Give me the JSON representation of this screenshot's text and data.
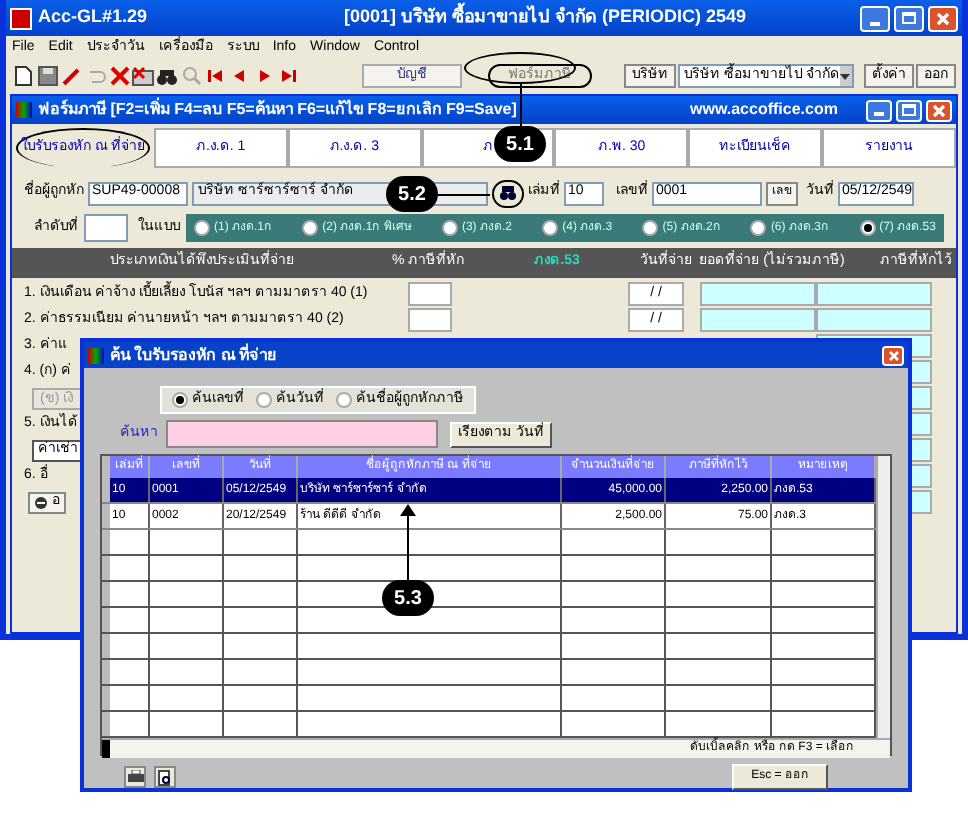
{
  "window": {
    "app": "Acc-GL#1.29",
    "title": "[0001]  บริษัท ซื้อมาขายไป จำกัด (PERIODIC)  2549"
  },
  "menu": [
    "File",
    "Edit",
    "ประจำวัน",
    "เครื่องมือ",
    "ระบบ",
    "Info",
    "Window",
    "Control"
  ],
  "toolbar": {
    "buttons": [
      {
        "label": "บัญชี",
        "selected": false
      },
      {
        "label": "ฟอร์มภาษี",
        "selected": true
      }
    ],
    "company_button": "บริษัท",
    "company_select": "บริษัท ซื้อมาขายไป จำกัด",
    "settings_button": "ตั้งค่า",
    "exit_button": "ออก"
  },
  "child_window": {
    "title": "ฟอร์มภาษี   [F2=เพิ่ม  F4=ลบ  F5=ค้นหา  F6=แก้ไข  F8=ยกเลิก  F9=Save]",
    "website": "www.accoffice.com"
  },
  "tabs": [
    {
      "label": "ใบรับรองหัก ณ ที่จ่าย",
      "selected": true
    },
    {
      "label": "ภ.ง.ด. 1",
      "selected": false
    },
    {
      "label": "ภ.ง.ด. 3",
      "selected": false
    },
    {
      "label": "ภ",
      "selected": false
    },
    {
      "label": "ภ.พ. 30",
      "selected": false
    },
    {
      "label": "ทะเบียนเช็ค",
      "selected": false
    },
    {
      "label": "รายงาน",
      "selected": false
    }
  ],
  "form": {
    "payee_label": "ชื่อผู้ถูกหัก",
    "payee_code": "SUP49-00008",
    "payee_name": "บริษัท ซาร์ซาร์ซาร์ จำกัด",
    "book_label": "เล่มที่",
    "book": "10",
    "number_label": "เลขที่",
    "number": "0001",
    "number_button": "เลข",
    "date_label": "วันที่",
    "date": "05/12/2549",
    "seq_label": "ลำดับที่",
    "form_label": "ในแบบ",
    "form_types": [
      {
        "label": "(1) ภงด.1ก",
        "selected": false
      },
      {
        "label": "(2) ภงด.1ก พิเศษ",
        "selected": false
      },
      {
        "label": "(3) ภงด.2",
        "selected": false
      },
      {
        "label": "(4) ภงด.3",
        "selected": false
      },
      {
        "label": "(5) ภงด.2ก",
        "selected": false
      },
      {
        "label": "(6) ภงด.3ก",
        "selected": false
      },
      {
        "label": "(7) ภงด.53",
        "selected": true
      }
    ]
  },
  "income_table": {
    "columns": [
      "ประเภทเงินได้พึงประเมินที่จ่าย",
      "% ภาษีที่หัก",
      "ภงด.53",
      "วันที่จ่าย",
      "ยอดที่จ่าย (ไม่รวมภาษี)",
      "ภาษีที่หักไว้"
    ],
    "rows": [
      {
        "kind": "text",
        "label": "1. เงินเดือน ค่าจ้าง เบี้ยเลี้ยง โบนัส ฯลฯ ตามมาตรา 40 (1)",
        "date": "/ /"
      },
      {
        "kind": "text",
        "label": "2. ค่าธรรมเนียม ค่านายหน้า ฯลฯ ตามมาตรา 40 (2)",
        "date": "/ /"
      },
      {
        "kind": "text",
        "label": "3. ค่าแ"
      },
      {
        "kind": "text",
        "label": "4. (ก) ค่"
      },
      {
        "kind": "button",
        "label": "(ข) เงิ"
      },
      {
        "kind": "text",
        "label": "5. เงินได้"
      },
      {
        "kind": "field",
        "label": "ค่าเช่า"
      },
      {
        "kind": "text",
        "label": "6. อื่"
      },
      {
        "kind": "icon_button",
        "label": "อ"
      }
    ]
  },
  "dialog": {
    "title": "ค้น ใบรับรองหัก ณ ที่จ่าย",
    "search_modes": [
      {
        "label": "ค้นเลขที่",
        "selected": true
      },
      {
        "label": "ค้นวันที่",
        "selected": false
      },
      {
        "label": "ค้นชื่อผู้ถูกหักภาษี",
        "selected": false
      }
    ],
    "search_label": "ค้นหา",
    "sort_button": "เรียงตาม วันที่",
    "columns": [
      "เล่มที่",
      "เลขที่",
      "วันที่",
      "ชื่อผู้ถูกหักภาษี ณ ที่จ่าย",
      "จำนวนเงินที่จ่าย",
      "ภาษีที่หักไว้",
      "หมายเหตุ"
    ],
    "rows": [
      {
        "selected": true,
        "cells": [
          "10",
          "0001",
          "05/12/2549",
          "บริษัท ซาร์ซาร์ซาร์ จำกัด",
          "45,000.00",
          "2,250.00",
          "ภงด.53"
        ]
      },
      {
        "selected": false,
        "cells": [
          "10",
          "0002",
          "20/12/2549",
          "ร้าน ดีดีดี จำกัด",
          "2,500.00",
          "75.00",
          "ภงด.3"
        ]
      }
    ],
    "hint": "ดับเบิ้ลคลิก หรือ กด F3 = เลือก",
    "close_button": "Esc = ออก"
  },
  "callouts": [
    "5.1",
    "5.2",
    "5.3"
  ]
}
